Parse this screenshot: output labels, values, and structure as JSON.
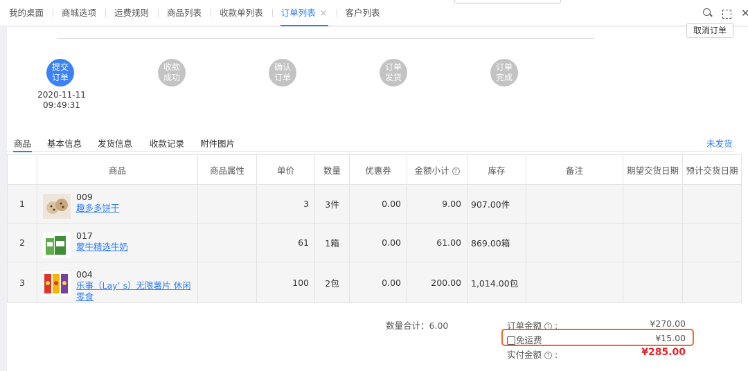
{
  "tabs": [
    {
      "label": "我的桌面"
    },
    {
      "label": "商城选项"
    },
    {
      "label": "运费规则"
    },
    {
      "label": "商品列表"
    },
    {
      "label": "收款单列表"
    },
    {
      "label": "订单列表",
      "close": "×"
    },
    {
      "label": "客户列表"
    }
  ],
  "active_tab": "订单列表",
  "cancel_button": "取消订单",
  "steps": [
    {
      "line1": "提交",
      "line2": "订单",
      "done": true
    },
    {
      "line1": "收款",
      "line2": "成功",
      "done": false
    },
    {
      "line1": "确认",
      "line2": "订单",
      "done": false
    },
    {
      "line1": "订单",
      "line2": "发货",
      "done": false
    },
    {
      "line1": "订单",
      "line2": "完成",
      "done": false
    }
  ],
  "step_time": {
    "date": "2020-11-11",
    "time": "09:49:31"
  },
  "subtabs": [
    "商品",
    "基本信息",
    "发货信息",
    "收款记录",
    "附件图片"
  ],
  "ship_status": "未发货",
  "table": {
    "headers": [
      "",
      "商品",
      "商品属性",
      "单价",
      "数量",
      "优惠券",
      "金额小计",
      "库存",
      "备注",
      "期望交货日期",
      "预计交货日期"
    ],
    "help_icon": "?",
    "rows": [
      {
        "no": "1",
        "code": "009",
        "name": "趣多多饼干",
        "attr": "",
        "price": "3",
        "qty": "3件",
        "coupon": "0.00",
        "subtotal": "9.00",
        "stock": "907.00件",
        "remark": "",
        "expect": "",
        "estimate": "",
        "thumb_color": "#d9c3a3",
        "thumb": "cookie-thumb"
      },
      {
        "no": "2",
        "code": "017",
        "name": "蒙牛精选牛奶",
        "attr": "",
        "price": "61",
        "qty": "1箱",
        "coupon": "0.00",
        "subtotal": "61.00",
        "stock": "869.00箱",
        "remark": "",
        "expect": "",
        "estimate": "",
        "thumb_color": "#5fae4b",
        "thumb": "milk-thumb"
      },
      {
        "no": "3",
        "code": "004",
        "name": "乐事（Lay’ s）无限薯片 休闲零食",
        "attr": "",
        "price": "100",
        "qty": "2包",
        "coupon": "0.00",
        "subtotal": "200.00",
        "stock": "1,014.00包",
        "remark": "",
        "expect": "",
        "estimate": "",
        "thumb_color": "#e0332b",
        "thumb": "chips-thumb"
      }
    ]
  },
  "summary": {
    "qty_label": "数量合计：",
    "qty_value": "6.00",
    "order_amount_label": "订单金额",
    "order_amount": "¥270.00",
    "free_shipping_label": "免运费",
    "shipping": "¥15.00",
    "paid_label": "实付金额",
    "paid": "¥285.00",
    "colon": ":"
  },
  "colors": {
    "accent": "#2f7cf6",
    "total": "#e3262b",
    "highlight": "#e86a2e"
  }
}
